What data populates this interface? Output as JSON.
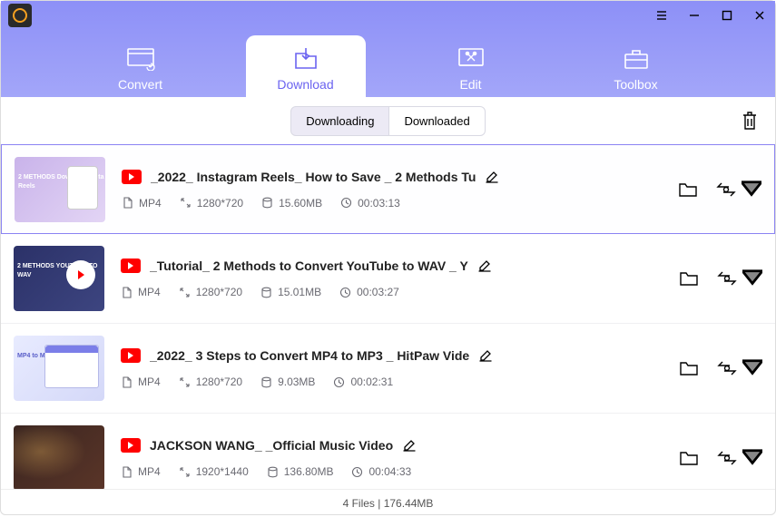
{
  "nav": {
    "convert": "Convert",
    "download": "Download",
    "edit": "Edit",
    "toolbox": "Toolbox"
  },
  "subtabs": {
    "downloading": "Downloading",
    "downloaded": "Downloaded"
  },
  "items": [
    {
      "title": "_2022_ Instagram Reels_ How to Save _ 2 Methods Tu",
      "format": "MP4",
      "resolution": "1280*720",
      "size": "15.60MB",
      "duration": "00:03:13",
      "thumb_text": "2 METHODS\nDownload\nInsta Reels"
    },
    {
      "title": "_Tutorial_ 2 Methods to Convert YouTube to WAV _ Y",
      "format": "MP4",
      "resolution": "1280*720",
      "size": "15.01MB",
      "duration": "00:03:27",
      "thumb_text": "2 METHODS\nYOUTUBE\nTO\nWAV"
    },
    {
      "title": "_2022_ 3 Steps to Convert MP4 to MP3 _ HitPaw Vide",
      "format": "MP4",
      "resolution": "1280*720",
      "size": "9.03MB",
      "duration": "00:02:31",
      "thumb_text": "MP4\nto\nMP3"
    },
    {
      "title": "JACKSON WANG_ _Official Music Video",
      "format": "MP4",
      "resolution": "1920*1440",
      "size": "136.80MB",
      "duration": "00:04:33",
      "thumb_text": ""
    }
  ],
  "footer": "4 Files | 176.44MB"
}
